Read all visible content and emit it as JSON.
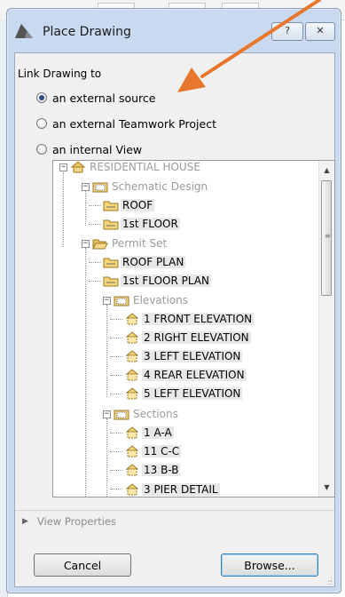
{
  "dialog": {
    "title": "Place Drawing",
    "help_button": "?",
    "close_button": "✕"
  },
  "link": {
    "label": "Link Drawing to",
    "options": [
      {
        "label": "an external source",
        "checked": true
      },
      {
        "label": "an external Teamwork Project",
        "checked": false
      },
      {
        "label": "an internal View",
        "checked": false
      }
    ]
  },
  "tree": {
    "nodes": [
      {
        "label": "RESIDENTIAL HOUSE",
        "expander": "−",
        "icon": "project-icon",
        "gray": true
      },
      {
        "label": "Schematic Design",
        "expander": "−",
        "icon": "folder-set-icon",
        "gray": true
      },
      {
        "label": "ROOF",
        "icon": "folder-icon"
      },
      {
        "label": "1st FLOOR",
        "icon": "folder-icon"
      },
      {
        "label": "Permit Set",
        "expander": "−",
        "icon": "open-folder-icon",
        "gray": true
      },
      {
        "label": "ROOF PLAN",
        "icon": "folder-icon"
      },
      {
        "label": "1st FLOOR PLAN",
        "icon": "folder-icon"
      },
      {
        "label": "Elevations",
        "expander": "−",
        "icon": "elevation-group-icon",
        "gray": true
      },
      {
        "label": "1 FRONT ELEVATION",
        "icon": "elevation-icon"
      },
      {
        "label": "2 RIGHT ELEVATION",
        "icon": "elevation-icon"
      },
      {
        "label": "3 LEFT ELEVATION",
        "icon": "elevation-icon"
      },
      {
        "label": "4 REAR ELEVATION",
        "icon": "elevation-icon"
      },
      {
        "label": "5 LEFT ELEVATION",
        "icon": "elevation-icon"
      },
      {
        "label": "Sections",
        "expander": "−",
        "icon": "section-group-icon",
        "gray": true
      },
      {
        "label": "1 A-A",
        "icon": "section-icon"
      },
      {
        "label": "11 C-C",
        "icon": "section-icon"
      },
      {
        "label": "13 B-B",
        "icon": "section-icon"
      },
      {
        "label": "3 PIER DETAIL",
        "icon": "section-icon"
      }
    ]
  },
  "view_properties": "View Properties",
  "buttons": {
    "cancel": "Cancel",
    "browse": "Browse..."
  },
  "colors": {
    "annotation_arrow": "#e8772e",
    "title_bar": "#c9daf0"
  }
}
